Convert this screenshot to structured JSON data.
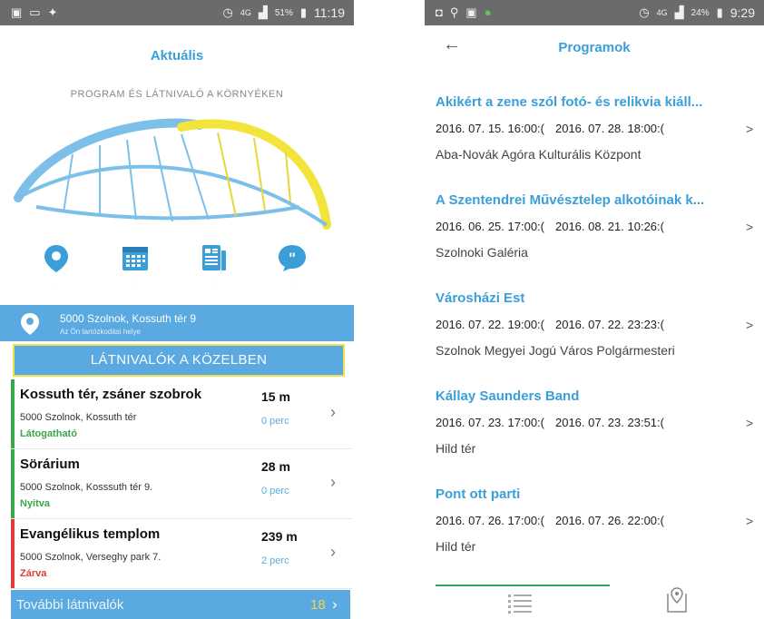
{
  "left": {
    "status": {
      "signal": "4G",
      "battery": "51%",
      "time": "11:19"
    },
    "title": "Aktuális",
    "subtitle": "PROGRAM ÉS LÁTNIVALÓ A KÖRNYÉKEN",
    "icons": [
      {
        "name": "map-pin-icon",
        "color": "#3a9fd8"
      },
      {
        "name": "calendar-icon",
        "color": "#3a9fd8"
      },
      {
        "name": "document-icon",
        "color": "#3a9fd8"
      },
      {
        "name": "quote-bubble-icon",
        "color": "#3a9fd8"
      }
    ],
    "address": {
      "line1": "5000 Szolnok, Kossuth tér 9",
      "line2": "Az Ön tartózkodási helye"
    },
    "nearby_button": "LÁTNIVALÓK A KÖZELBEN",
    "sights": [
      {
        "name": "Kossuth tér, zsáner szobrok",
        "address": "5000 Szolnok, Kossuth tér",
        "status": "Látogatható",
        "status_color": "#3aa64a",
        "distance": "15 m",
        "walk": "0 perc"
      },
      {
        "name": "Sörárium",
        "address": "5000 Szolnok, Kosssuth tér 9.",
        "status": "Nyitva",
        "status_color": "#3aa64a",
        "distance": "28 m",
        "walk": "0 perc"
      },
      {
        "name": "Evangélikus templom",
        "address": "5000 Szolnok, Verseghy park 7.",
        "status": "Zárva",
        "status_color": "#e03a3a",
        "distance": "239 m",
        "walk": "2 perc"
      }
    ],
    "more": {
      "label": "További látnivalók",
      "count": "18"
    }
  },
  "right": {
    "status": {
      "signal": "4G",
      "battery": "24%",
      "time": "9:29"
    },
    "title": "Programok",
    "events": [
      {
        "title": "Akikért a zene szól fotó- és relikvia kiáll...",
        "start": "2016. 07. 15. 16:00:(",
        "end": "2016. 07. 28. 18:00:(",
        "place": "Aba-Novák Agóra Kulturális Központ"
      },
      {
        "title": "A Szentendrei Művésztelep alkotóinak k...",
        "start": "2016. 06. 25. 17:00:(",
        "end": "2016. 08. 21. 10:26:(",
        "place": "Szolnoki Galéria"
      },
      {
        "title": "Városházi Est",
        "start": "2016. 07. 22. 19:00:(",
        "end": "2016. 07. 22. 23:23:(",
        "place": "Szolnok Megyei Jogú Város Polgármesteri"
      },
      {
        "title": "Kállay Saunders Band",
        "start": "2016. 07. 23. 17:00:(",
        "end": "2016. 07. 23. 23:51:(",
        "place": "Hild tér"
      },
      {
        "title": "Pont ott parti",
        "start": "2016. 07. 26. 17:00:(",
        "end": "2016. 07. 26. 22:00:(",
        "place": "Hild tér"
      }
    ],
    "tabs": [
      {
        "name": "list-tab-icon",
        "active": true
      },
      {
        "name": "map-tab-icon",
        "active": false
      }
    ]
  }
}
